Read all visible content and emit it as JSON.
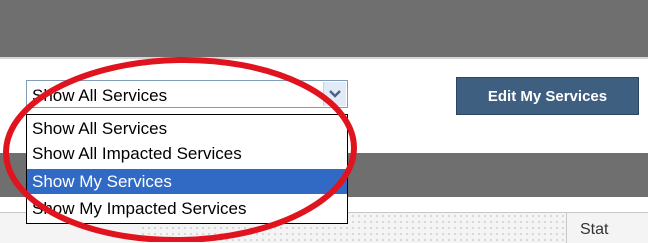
{
  "filter": {
    "selected_label": "Show All Services",
    "options": [
      {
        "label": "Show All Services",
        "selected": false
      },
      {
        "label": "Show All Impacted Services",
        "selected": false
      },
      {
        "label": "Show My Services",
        "selected": true
      },
      {
        "label": "Show My Impacted Services",
        "selected": false
      }
    ]
  },
  "toolbar": {
    "edit_label": "Edit My Services"
  },
  "table": {
    "status_header_partial": "Stat"
  },
  "colors": {
    "header_bar": "#6f6f6f",
    "edit_button": "#3f5f80",
    "selection_highlight": "#316ac5",
    "annotation_circle": "#e0141e"
  },
  "icons": {
    "select_arrow": "chevron-down-icon"
  }
}
